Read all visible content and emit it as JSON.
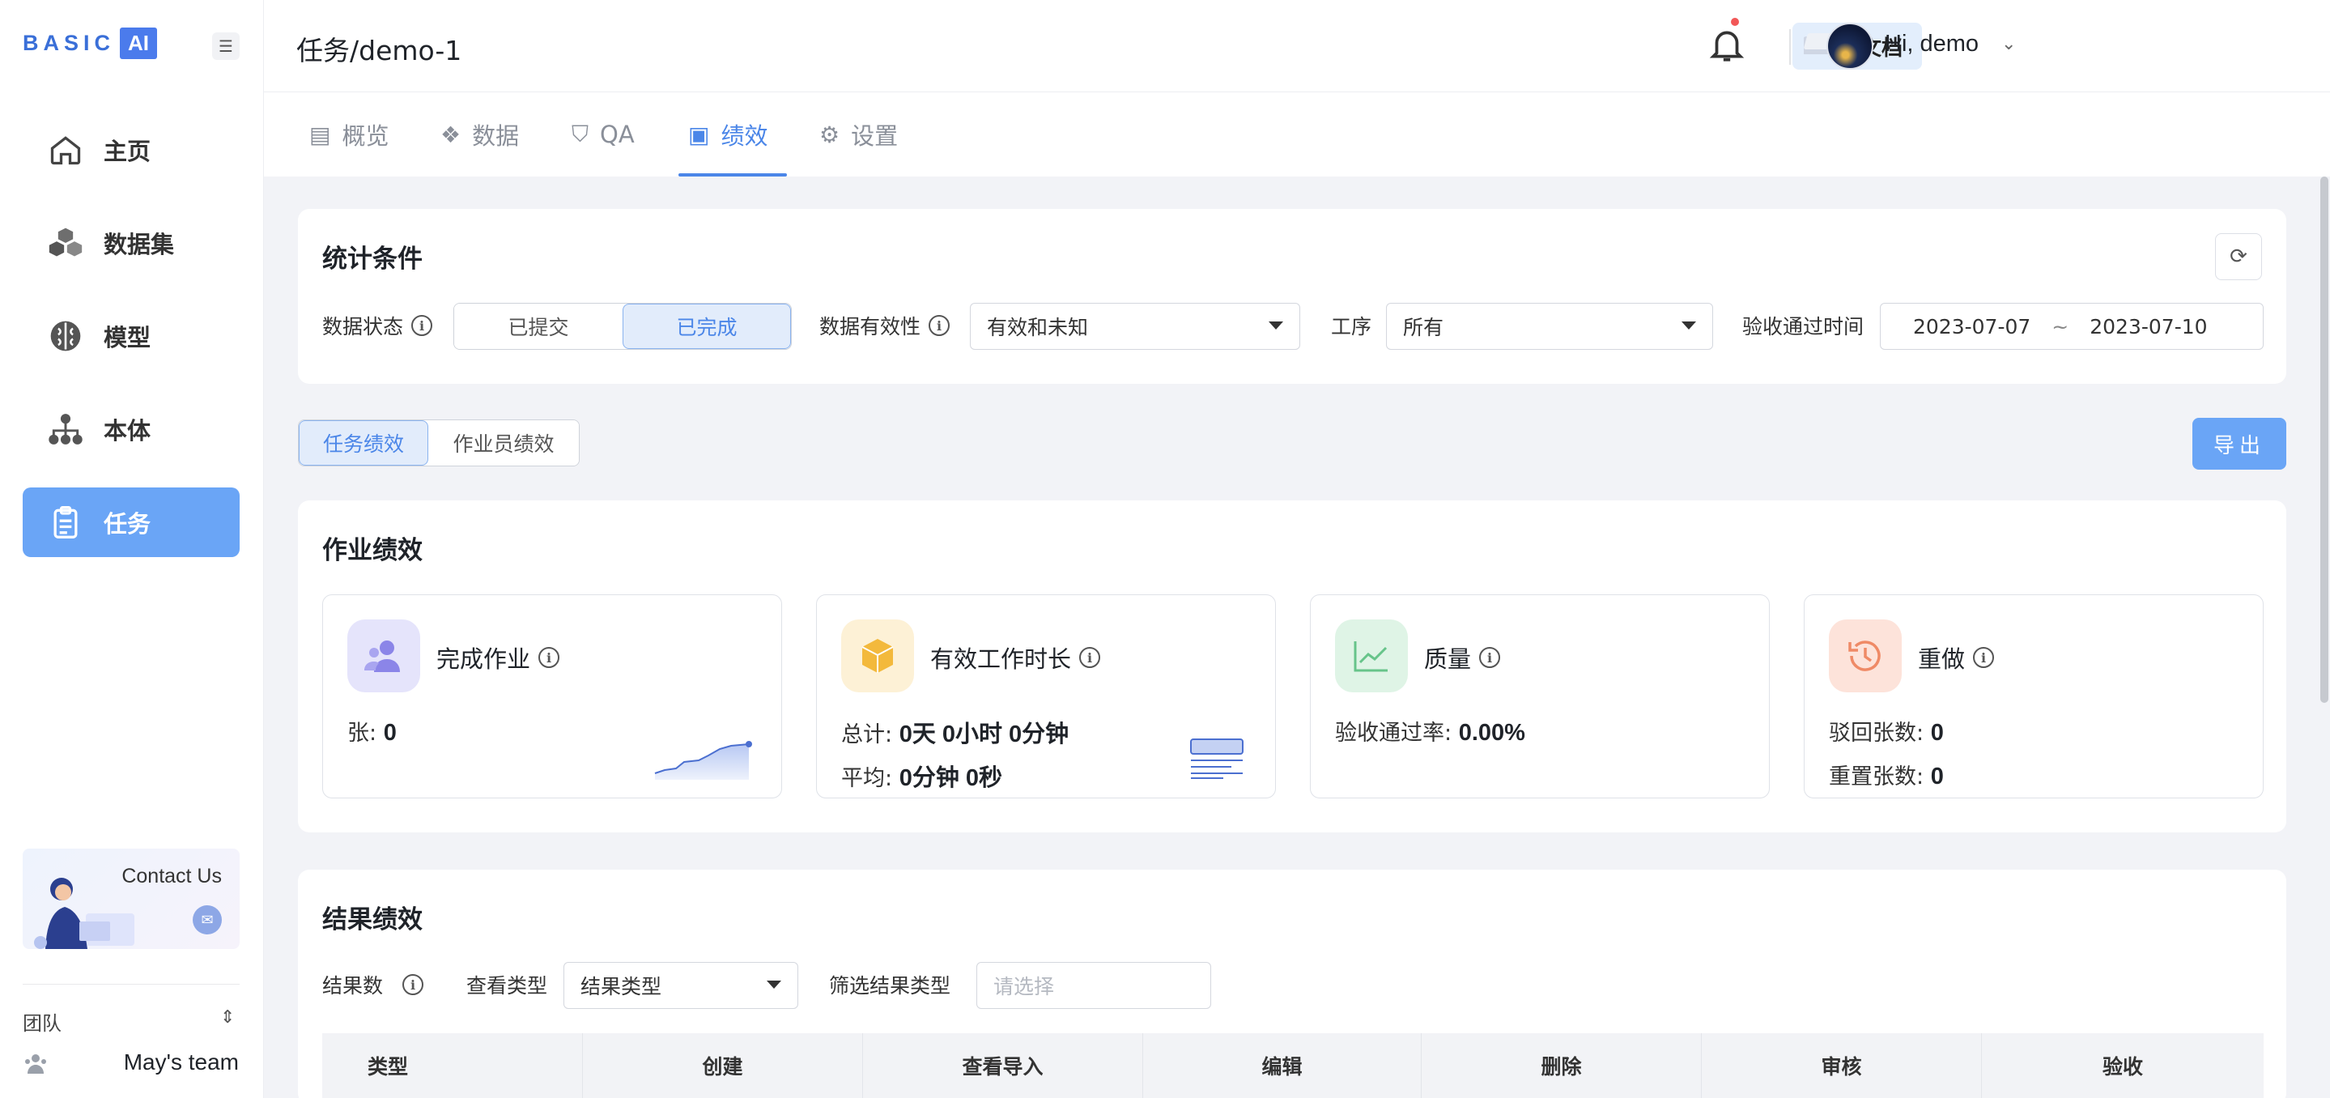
{
  "brand": {
    "logo_text": "BASIC",
    "logo_ai": "AI"
  },
  "sidebar": {
    "items": [
      {
        "label": "主页",
        "icon": "home-icon",
        "active": false
      },
      {
        "label": "数据集",
        "icon": "cubes-icon",
        "active": false
      },
      {
        "label": "模型",
        "icon": "brain-icon",
        "active": false
      },
      {
        "label": "本体",
        "icon": "hierarchy-icon",
        "active": false
      },
      {
        "label": "任务",
        "icon": "clipboard-icon",
        "active": true
      }
    ],
    "contact": "Contact Us",
    "team_label": "团队",
    "team_name": "May's team"
  },
  "header": {
    "breadcrumb": "任务/demo-1",
    "docs_label": "文档",
    "greeting": "Hi, demo"
  },
  "tabs": [
    {
      "label": "概览",
      "active": false
    },
    {
      "label": "数据",
      "active": false
    },
    {
      "label": "QA",
      "active": false
    },
    {
      "label": "绩效",
      "active": true
    },
    {
      "label": "设置",
      "active": false
    }
  ],
  "filters": {
    "title": "统计条件",
    "data_status_label": "数据状态",
    "status_options": [
      "已提交",
      "已完成"
    ],
    "status_selected": "已完成",
    "validity_label": "数据有效性",
    "validity_value": "有效和未知",
    "stage_label": "工序",
    "stage_value": "所有",
    "accept_time_label": "验收通过时间",
    "date_from": "2023-07-07",
    "date_sep": "~",
    "date_to": "2023-07-10"
  },
  "perf_tabs": {
    "task": "任务绩效",
    "worker": "作业员绩效",
    "selected": "任务绩效"
  },
  "export_label": "导出",
  "work_perf": {
    "title": "作业绩效",
    "metrics": [
      {
        "title": "完成作业",
        "lines": [
          {
            "k": "张: ",
            "v": "0"
          }
        ]
      },
      {
        "title": "有效工作时长",
        "lines": [
          {
            "k": "总计: ",
            "v": "0天 0小时 0分钟"
          },
          {
            "k": "平均: ",
            "v": "0分钟 0秒"
          }
        ]
      },
      {
        "title": "质量",
        "lines": [
          {
            "k": "验收通过率: ",
            "v": "0.00%"
          }
        ]
      },
      {
        "title": "重做",
        "lines": [
          {
            "k": "驳回张数: ",
            "v": "0"
          },
          {
            "k": "重置张数: ",
            "v": "0"
          }
        ]
      }
    ]
  },
  "result_perf": {
    "title": "结果绩效",
    "count_label": "结果数",
    "view_type_label": "查看类型",
    "view_type_value": "结果类型",
    "filter_label": "筛选结果类型",
    "filter_placeholder": "请选择",
    "columns": [
      "类型",
      "创建",
      "查看导入",
      "编辑",
      "删除",
      "审核",
      "验收"
    ]
  },
  "colors": {
    "accent": "#4b86e8",
    "active_nav": "#6aa5f6"
  }
}
